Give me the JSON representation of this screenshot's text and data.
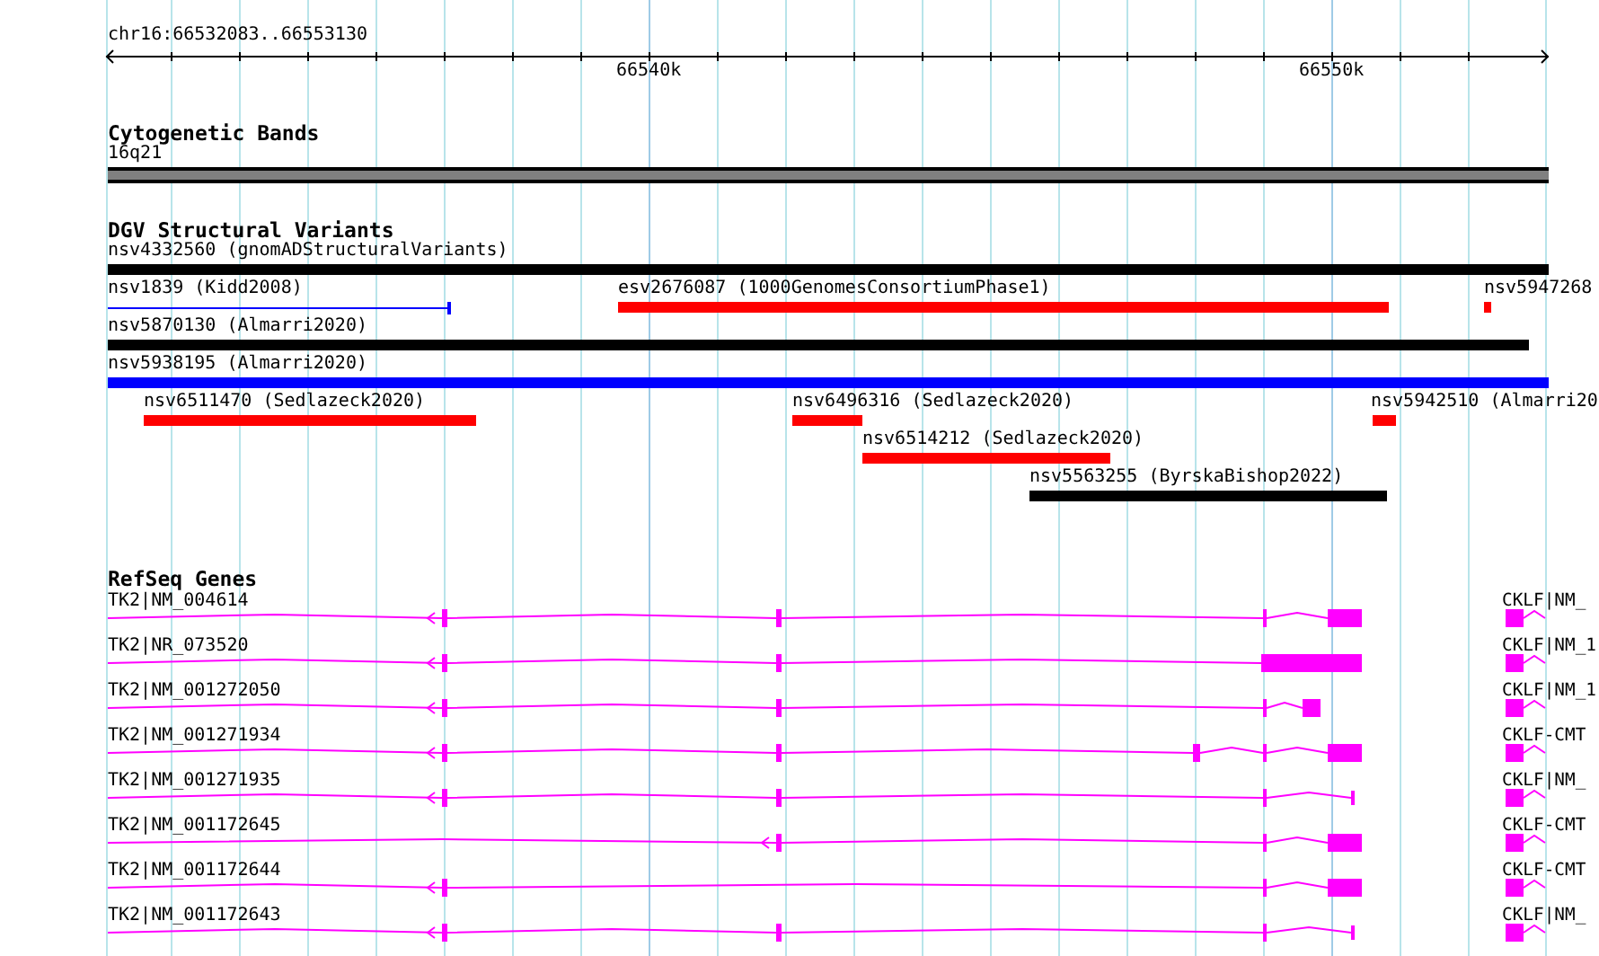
{
  "ruler": {
    "location": "chr16:66532083..66553130",
    "ticks": [
      "66540k",
      "66550k"
    ]
  },
  "tracks": [
    {
      "kind": "bands",
      "title": "Cytogenetic Bands",
      "features": [
        {
          "label": "16q21"
        }
      ]
    },
    {
      "kind": "variants",
      "title": "DGV Structural Variants",
      "features": [
        {
          "label": "nsv4332560 (gnomADStructuralVariants)",
          "color": "#000000"
        },
        {
          "label": "nsv1839 (Kidd2008)",
          "color": "#0000ff"
        },
        {
          "label": "esv2676087 (1000GenomesConsortiumPhase1)",
          "color": "#ff0000"
        },
        {
          "label": "nsv5947268",
          "color": "#ff0000"
        },
        {
          "label": "nsv5870130 (Almarri2020)",
          "color": "#000000"
        },
        {
          "label": "nsv5938195 (Almarri2020)",
          "color": "#0000ff"
        },
        {
          "label": "nsv6511470 (Sedlazeck2020)",
          "color": "#ff0000"
        },
        {
          "label": "nsv6496316 (Sedlazeck2020)",
          "color": "#ff0000"
        },
        {
          "label": "nsv5942510 (Almarri20",
          "color": "#ff0000"
        },
        {
          "label": "nsv6514212 (Sedlazeck2020)",
          "color": "#ff0000"
        },
        {
          "label": "nsv5563255 (ByrskaBishop2022)",
          "color": "#000000"
        }
      ]
    },
    {
      "kind": "genes",
      "title": "RefSeq Genes",
      "features": [
        {
          "label": "TK2|NM_004614",
          "neighbor": "CKLF|NM_"
        },
        {
          "label": "TK2|NR_073520",
          "neighbor": "CKLF|NM_1"
        },
        {
          "label": "TK2|NM_001272050",
          "neighbor": "CKLF|NM_1"
        },
        {
          "label": "TK2|NM_001271934",
          "neighbor": "CKLF-CMT"
        },
        {
          "label": "TK2|NM_001271935",
          "neighbor": "CKLF|NM_"
        },
        {
          "label": "TK2|NM_001172645",
          "neighbor": "CKLF-CMT"
        },
        {
          "label": "TK2|NM_001172644",
          "neighbor": "CKLF-CMT"
        },
        {
          "label": "TK2|NM_001172643",
          "neighbor": "CKLF|NM_"
        }
      ]
    }
  ]
}
